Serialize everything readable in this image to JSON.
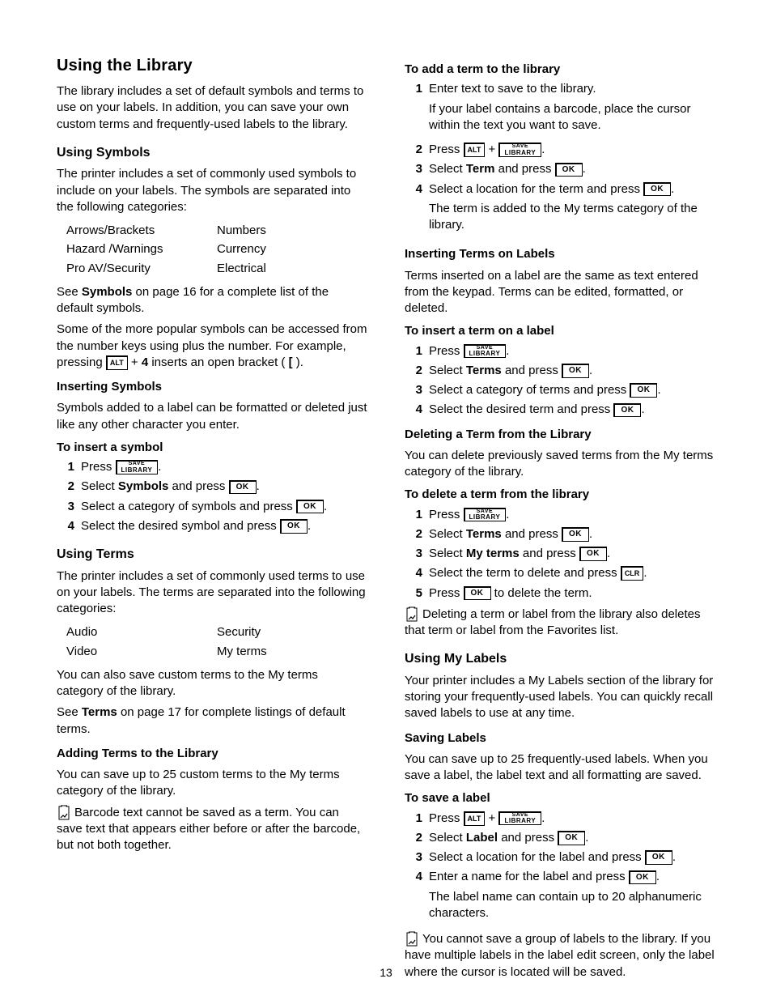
{
  "pageNumber": "13",
  "keys": {
    "ok": "OK",
    "alt": "ALT",
    "clr": "CLR",
    "save": "SAVE",
    "library": "LIBRARY"
  },
  "left": {
    "h1": "Using the Library",
    "intro": "The library includes a set of default symbols and terms to use on your labels. In addition, you can save your own custom terms and frequently-used labels to the library.",
    "usingSymbols": {
      "h2": "Using Symbols",
      "p1": "The printer includes a set of commonly used symbols to include on your labels. The symbols are separated into the following categories:",
      "catsL": [
        "Arrows/Brackets",
        "Hazard /Warnings",
        "Pro AV/Security"
      ],
      "catsR": [
        "Numbers",
        "Currency",
        "Electrical"
      ],
      "p2a": "See ",
      "p2b": "Symbols",
      "p2c": " on page 16 for a complete list of the default symbols.",
      "p3a": "Some of the more popular symbols can be accessed from the number keys using plus the number. For example, pressing ",
      "p3b": " + ",
      "p3c": "4",
      "p3d": " inserts an open bracket ( ",
      "p3e": "[",
      "p3f": " )."
    },
    "insertingSymbols": {
      "h3": "Inserting Symbols",
      "p1": "Symbols added to a label can be formatted or deleted just like any other character you enter.",
      "h4": "To insert a symbol",
      "s1a": "Press ",
      "s2a": "Select ",
      "s2b": "Symbols",
      "s2c": " and press ",
      "s3a": "Select a category of symbols and press ",
      "s4a": "Select the desired symbol and press "
    },
    "usingTerms": {
      "h2": "Using Terms",
      "p1": "The printer includes a set of commonly used terms to use on your labels. The terms are separated into the following categories:",
      "catsL": [
        "Audio",
        "Video"
      ],
      "catsR": [
        "Security",
        "My terms"
      ],
      "p2": "You can also save custom terms to the My terms category of the library.",
      "p3a": "See ",
      "p3b": "Terms",
      "p3c": " on page 17 for complete listings of default terms."
    },
    "addingTerms": {
      "h3": "Adding Terms to the Library",
      "p1": "You can save up to 25 custom terms to the My terms category of the library.",
      "note": "Barcode text cannot be saved as a term. You can save text that appears either before or after the barcode, but not both together."
    }
  },
  "right": {
    "toAddTerm": {
      "h4": "To add a term to the library",
      "s1a": "Enter text to save to the library.",
      "s1b": "If your label contains a barcode, place the cursor within the text you want to save.",
      "s2a": "Press ",
      "s2b": " + ",
      "s3a": "Select ",
      "s3b": "Term",
      "s3c": " and press ",
      "s4a": "Select a location for the term and press ",
      "s4b": "The term is added to the My terms category of the library."
    },
    "insertingTerms": {
      "h3": "Inserting Terms on Labels",
      "p1": "Terms inserted on a label are the same as text entered from the keypad. Terms can be edited, formatted, or deleted.",
      "h4": "To insert a term on a label",
      "s1a": "Press ",
      "s2a": "Select ",
      "s2b": "Terms",
      "s2c": " and press ",
      "s3a": "Select a category of terms and press ",
      "s4a": "Select the desired term and press "
    },
    "deletingTerm": {
      "h3": "Deleting a Term from the Library",
      "p1": "You can delete previously saved terms from the My terms category of the library.",
      "h4": "To delete a term from the library",
      "s1a": "Press ",
      "s2a": "Select ",
      "s2b": "Terms",
      "s2c": " and press ",
      "s3a": "Select ",
      "s3b": "My terms",
      "s3c": " and press ",
      "s4a": "Select the term to delete and press ",
      "s5a": "Press ",
      "s5b": " to delete the term.",
      "note": "Deleting a term or label from the library also deletes that term or label from the Favorites list."
    },
    "myLabels": {
      "h2": "Using My Labels",
      "p1": "Your printer includes a My Labels section of the library for storing your frequently-used labels. You can quickly recall saved labels to use at any time."
    },
    "savingLabels": {
      "h3": "Saving Labels",
      "p1": "You can save up to 25 frequently-used labels. When you save a label, the label text and all formatting are saved.",
      "h4": "To save a label",
      "s1a": "Press ",
      "s1b": " + ",
      "s2a": "Select ",
      "s2b": "Label",
      "s2c": " and press ",
      "s3a": "Select a location for the label and press ",
      "s4a": "Enter a name for the label and press ",
      "s4b": "The label name can contain up to 20 alphanumeric characters.",
      "note": "You cannot save a group of labels to the library. If you have multiple labels in the label edit screen, only the label where the cursor is located will be saved."
    }
  }
}
